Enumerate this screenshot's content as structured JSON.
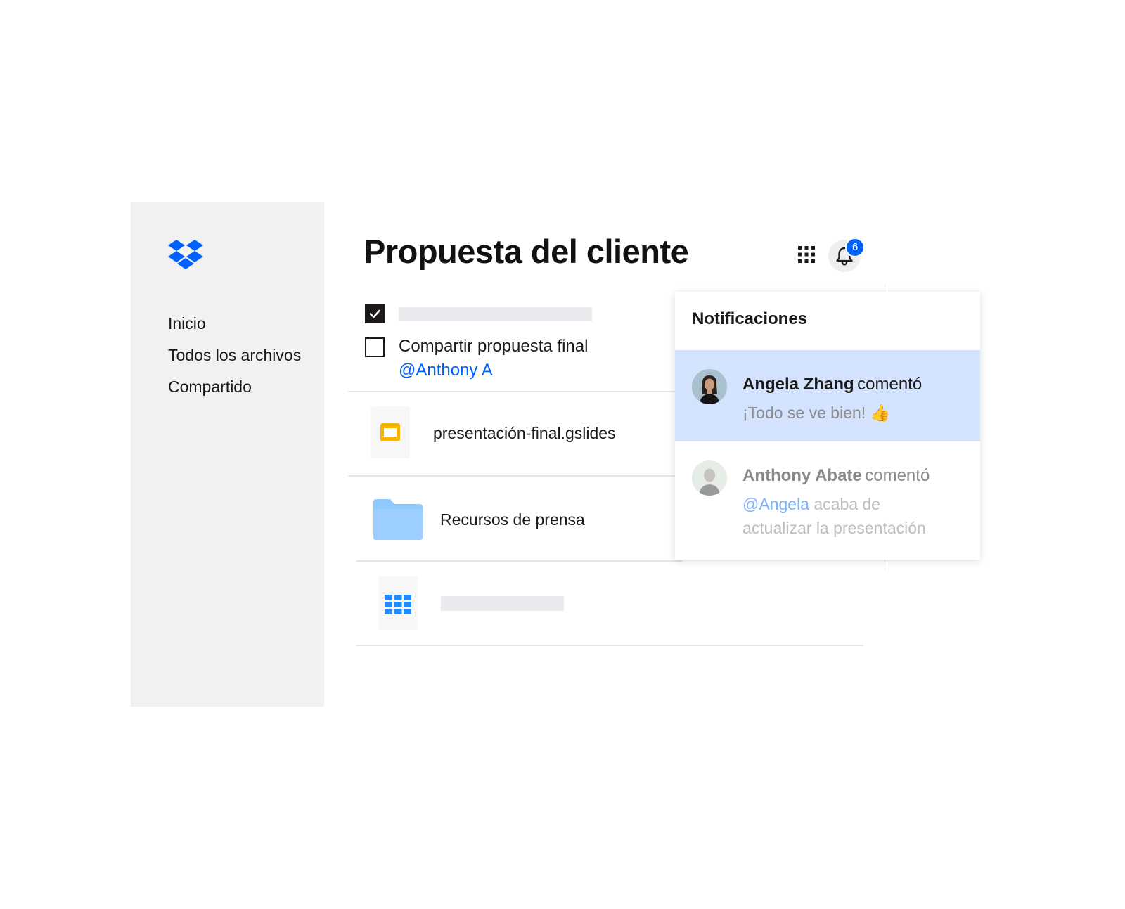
{
  "sidebar": {
    "logo_icon": "dropbox-logo-icon",
    "items": [
      {
        "label": "Inicio"
      },
      {
        "label": "Todos los archivos"
      },
      {
        "label": "Compartido"
      }
    ]
  },
  "header": {
    "title": "Propuesta del cliente",
    "apps_icon": "app-grid-icon",
    "bell_icon": "bell-icon",
    "notification_count": "6"
  },
  "tasks": {
    "task2_text": "Compartir propuesta final",
    "task2_mention": "@Anthony A",
    "task1_checked": true,
    "task2_checked": false
  },
  "files": [
    {
      "name": "presentación-final.gslides",
      "icon": "slides-icon"
    },
    {
      "name": "Recursos de prensa",
      "icon": "folder-icon"
    },
    {
      "name": "",
      "icon": "spreadsheet-icon"
    }
  ],
  "notifications": {
    "title": "Notificaciones",
    "items": [
      {
        "name": "Angela Zhang",
        "verb": "comentó",
        "body": "¡Todo se ve bien! 👍",
        "highlighted": true
      },
      {
        "name": "Anthony Abate",
        "verb": "comentó",
        "mention": "@Angela",
        "body_rest": " acaba de",
        "body_line2": "actualizar la presentación",
        "highlighted": false
      }
    ]
  },
  "colors": {
    "accent": "#0061fe",
    "sidebar_bg": "#f1f1f1",
    "highlight_bg": "#d3e3fd",
    "folder": "#8fcaff",
    "slides": "#f7b500"
  }
}
